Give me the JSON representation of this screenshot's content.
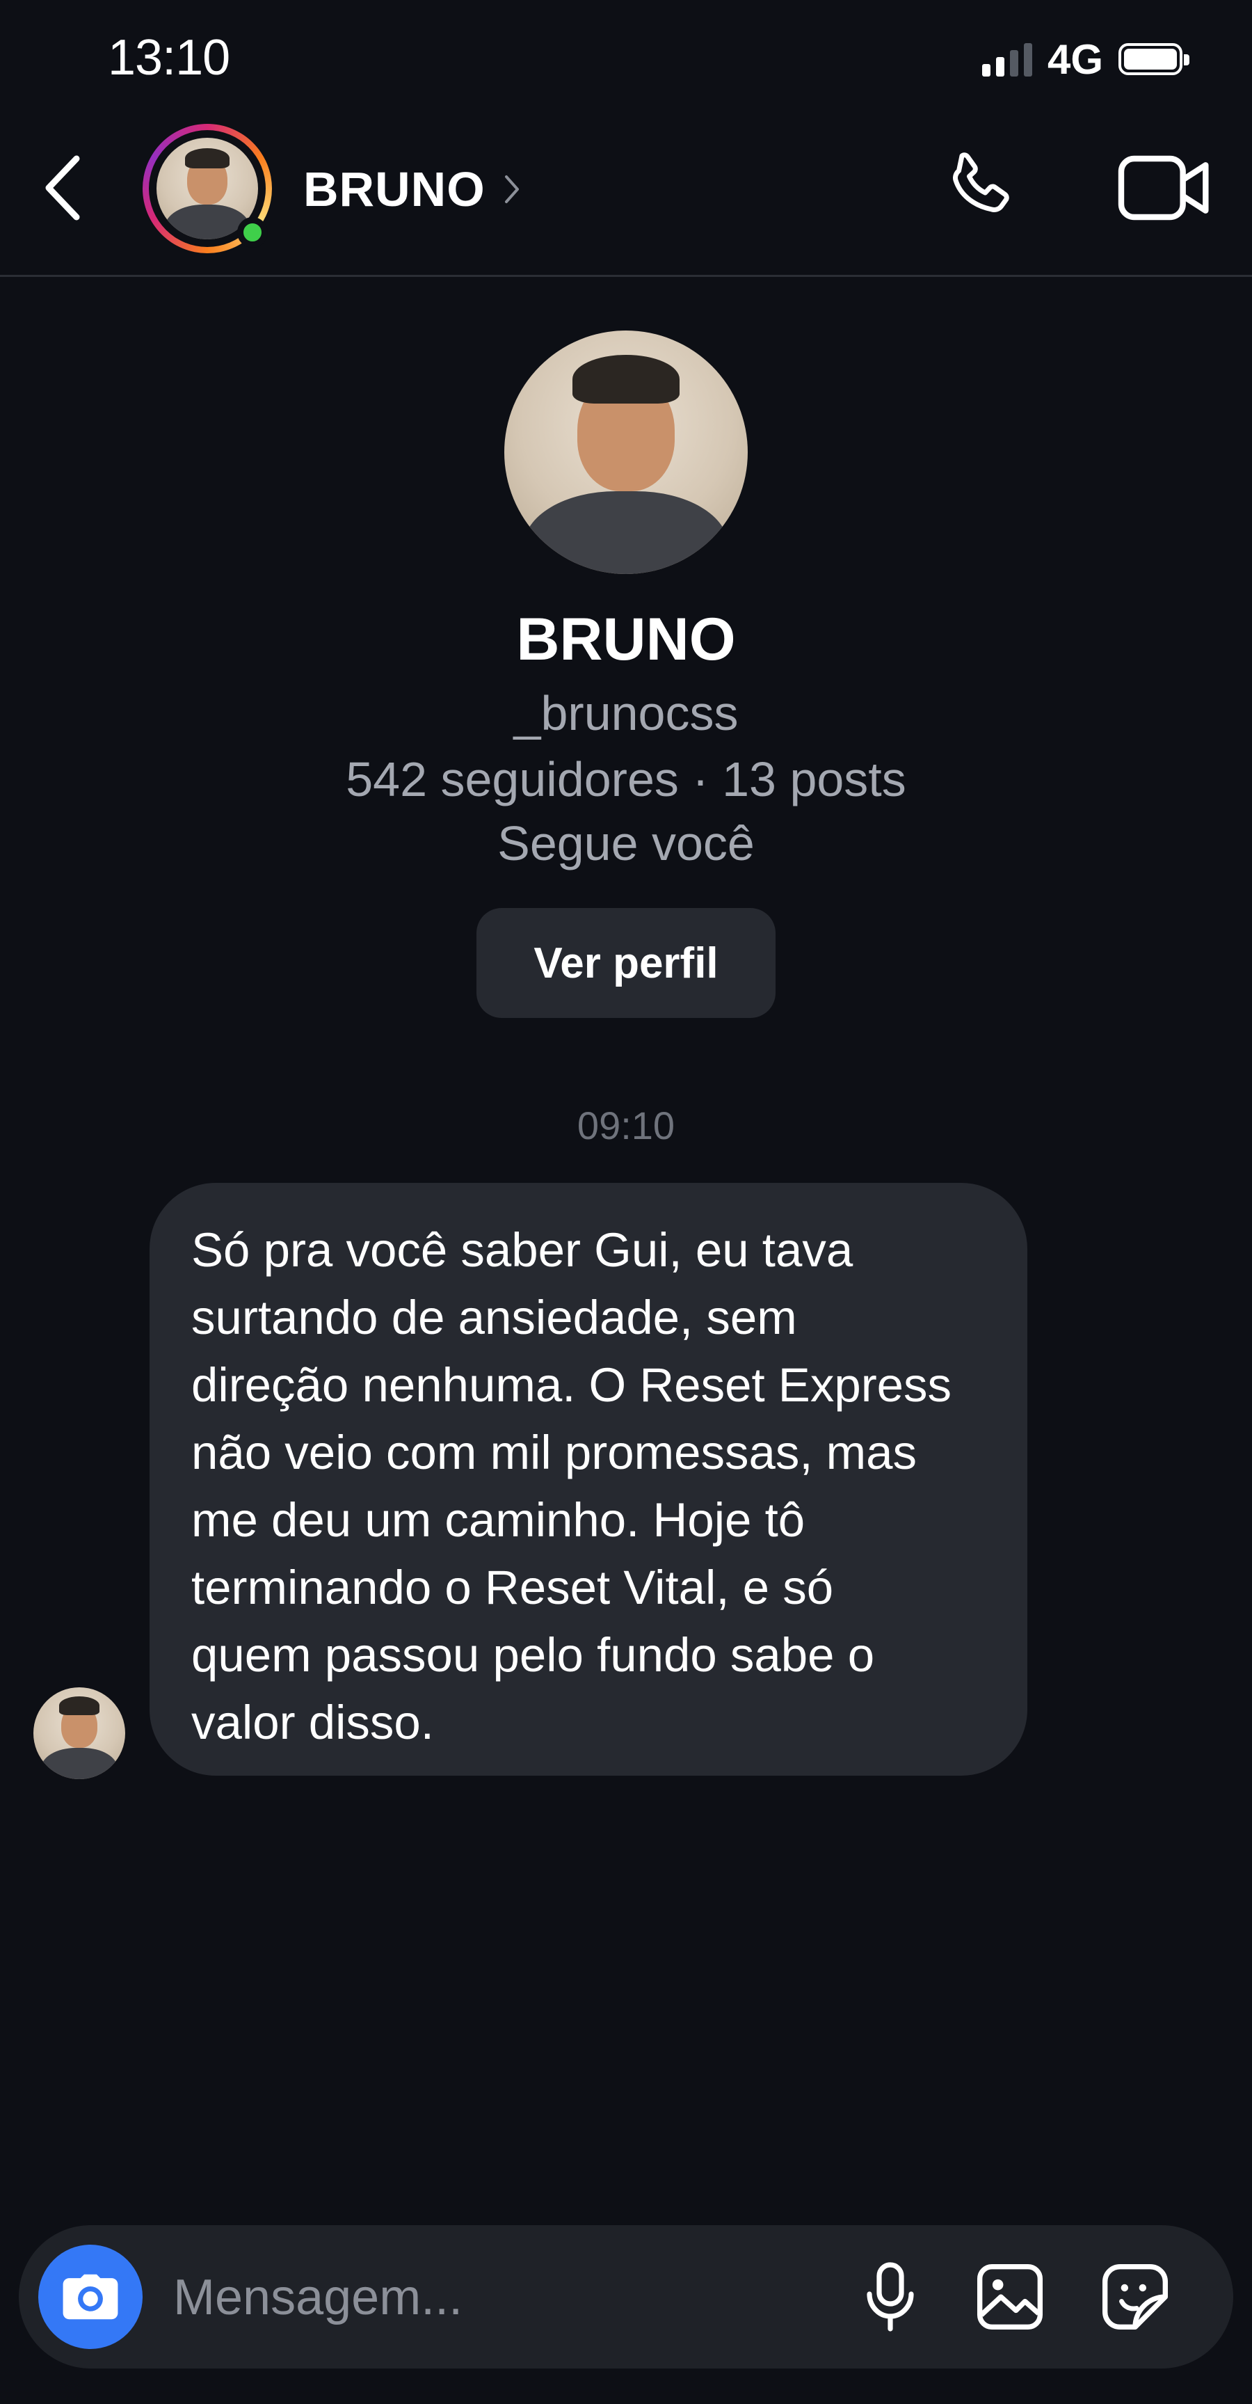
{
  "status_bar": {
    "time": "13:10",
    "network": "4G",
    "signal_bars": 2,
    "signal_bars_total": 4,
    "battery_level": 1.0
  },
  "header": {
    "name": "BRUNO",
    "online": true,
    "icons": {
      "back": "chevron-left-icon",
      "name_chevron": "chevron-right-icon",
      "call": "phone-icon",
      "video": "video-camera-icon"
    }
  },
  "profile": {
    "name": "BRUNO",
    "handle": "_brunocss",
    "stats": "542 seguidores · 13 posts",
    "relationship": "Segue você",
    "view_profile_label": "Ver perfil"
  },
  "conversation": {
    "timestamp": "09:10",
    "messages": [
      {
        "direction": "incoming",
        "text": "Só pra você saber Gui, eu tava\nsurtando de ansiedade, sem\ndireção nenhuma. O Reset Express\nnão veio com mil promessas, mas\nme deu um caminho. Hoje tô\nterminando o Reset Vital, e só\nquem passou pelo fundo sabe o\nvalor disso."
      }
    ]
  },
  "composer": {
    "placeholder": "Mensagem...",
    "icons": {
      "camera": "camera-icon",
      "mic": "microphone-icon",
      "gallery": "image-icon",
      "sticker": "sticker-icon"
    }
  },
  "colors": {
    "background": "#0d0f15",
    "bubble": "#262930",
    "accent_blue": "#3478f6",
    "online_green": "#3fcf4a",
    "secondary_text": "#a4a8b1"
  }
}
